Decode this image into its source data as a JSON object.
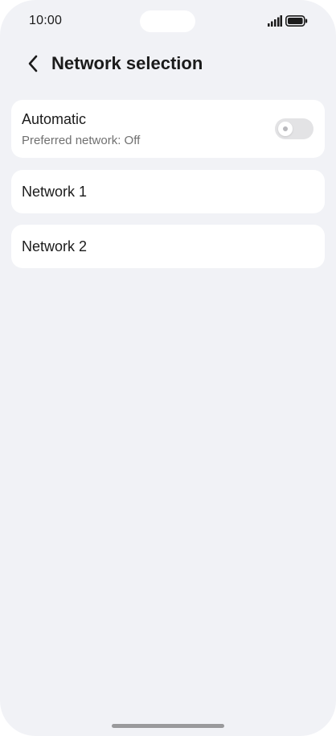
{
  "status_bar": {
    "time": "10:00",
    "signal_icon": "signal-bars-icon",
    "battery_icon": "battery-icon"
  },
  "header": {
    "back_icon": "chevron-left-icon",
    "title": "Network selection"
  },
  "settings": {
    "automatic": {
      "label": "Automatic",
      "subtitle": "Preferred network: Off",
      "toggle_on": false
    },
    "networks": [
      {
        "label": "Network 1"
      },
      {
        "label": "Network 2"
      }
    ]
  },
  "colors": {
    "background": "#f1f2f6",
    "card": "#ffffff",
    "text": "#1b1b1b",
    "subtext": "#707070",
    "toggle_off_track": "#e3e3e5"
  }
}
